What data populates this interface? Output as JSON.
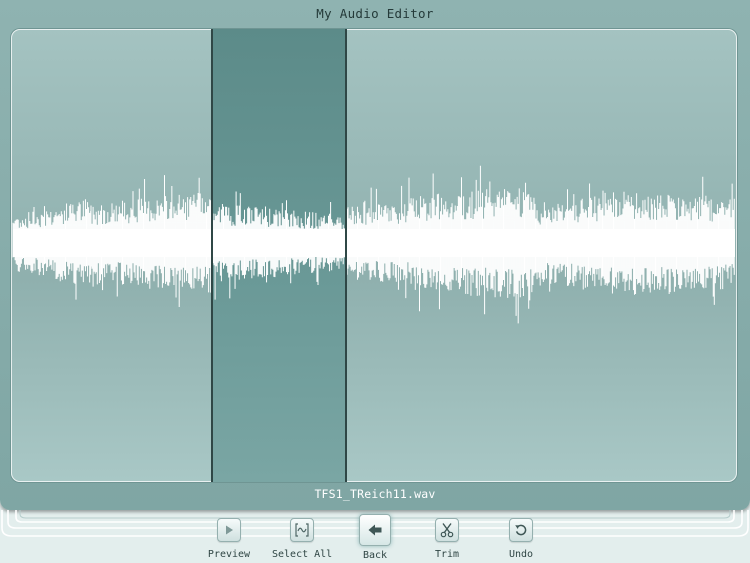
{
  "app": {
    "title": "My Audio Editor"
  },
  "file": {
    "name": "TFS1_TReich11.wav"
  },
  "toolbar": {
    "preview_label": "Preview",
    "select_all_label": "Select All",
    "back_label": "Back",
    "trim_label": "Trim",
    "undo_label": "Undo"
  },
  "colors": {
    "window": "#8fb3b1",
    "waveform": "#ffffff",
    "selection": "#6a9997",
    "marker": "#2f4746"
  }
}
